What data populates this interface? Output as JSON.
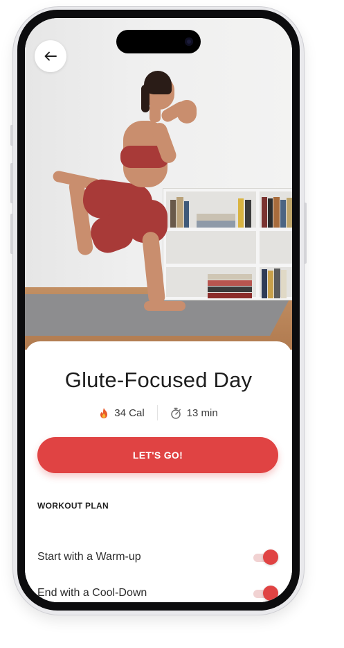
{
  "workout": {
    "title": "Glute-Focused Day",
    "calories": "34 Cal",
    "duration": "13 min"
  },
  "cta": {
    "label": "LET'S GO!"
  },
  "plan": {
    "heading": "WORKOUT PLAN",
    "options": [
      {
        "label": "Start with a Warm-up",
        "enabled": true
      },
      {
        "label": "End with a Cool-Down",
        "enabled": true
      }
    ]
  },
  "icons": {
    "back": "arrow-left-icon",
    "calories": "flame-icon",
    "duration": "stopwatch-icon"
  },
  "colors": {
    "accent": "#e04343",
    "toggle_track": "#f1d2d2",
    "text": "#1e1e1e"
  }
}
